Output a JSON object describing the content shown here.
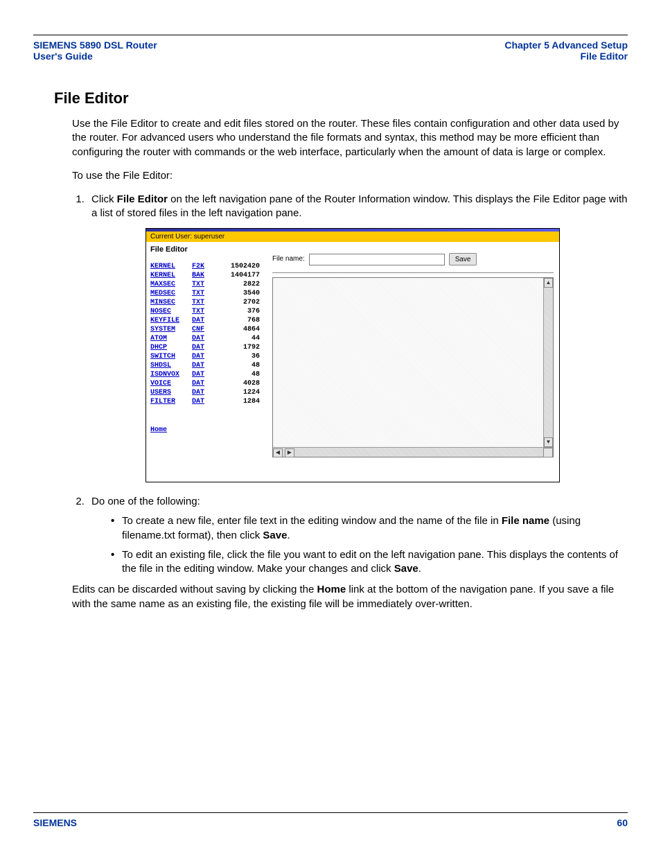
{
  "header": {
    "left_line1": "SIEMENS 5890 DSL Router",
    "left_line2": "User's Guide",
    "right_line1": "Chapter 5  Advanced Setup",
    "right_line2": "File Editor"
  },
  "heading": "File Editor",
  "intro": "Use the File Editor to create and edit files stored on the router. These files contain configuration and other data used by the router. For advanced users who understand the file formats and syntax, this method may be more efficient than configuring the router with commands or the web interface, particularly when the amount of data is large or complex.",
  "lead_in": "To use the File Editor:",
  "step1_pre": "Click ",
  "step1_bold": "File Editor",
  "step1_post": " on the left navigation pane of the Router Information window. This displays the File Editor page with a list of stored files in the left navigation pane.",
  "screenshot": {
    "user_bar": "Current User: superuser",
    "side_title": "File Editor",
    "files": [
      {
        "name": "KERNEL",
        "ext": "F2K",
        "size": "1502420"
      },
      {
        "name": "KERNEL",
        "ext": "BAK",
        "size": "1404177"
      },
      {
        "name": "MAXSEC",
        "ext": "TXT",
        "size": "2822"
      },
      {
        "name": "MEDSEC",
        "ext": "TXT",
        "size": "3540"
      },
      {
        "name": "MINSEC",
        "ext": "TXT",
        "size": "2702"
      },
      {
        "name": "NOSEC",
        "ext": "TXT",
        "size": "376"
      },
      {
        "name": "KEYFILE",
        "ext": "DAT",
        "size": "768"
      },
      {
        "name": "SYSTEM",
        "ext": "CNF",
        "size": "4864"
      },
      {
        "name": "ATOM",
        "ext": "DAT",
        "size": "44"
      },
      {
        "name": "DHCP",
        "ext": "DAT",
        "size": "1792"
      },
      {
        "name": "SWITCH",
        "ext": "DAT",
        "size": "36"
      },
      {
        "name": "SHDSL",
        "ext": "DAT",
        "size": "48"
      },
      {
        "name": "ISDNVOX",
        "ext": "DAT",
        "size": "48"
      },
      {
        "name": "VOICE",
        "ext": "DAT",
        "size": "4028"
      },
      {
        "name": "USERS",
        "ext": "DAT",
        "size": "1224"
      },
      {
        "name": "FILTER",
        "ext": "DAT",
        "size": "1284"
      }
    ],
    "home_link": "Home",
    "file_name_label": "File name:",
    "save_label": "Save"
  },
  "step2_lead": "Do one of the following:",
  "bullet1_pre": "To create a new file, enter file text in the editing window and the name of the file in ",
  "bullet1_b1": "File name",
  "bullet1_mid": " (using filename.txt format), then click ",
  "bullet1_b2": "Save",
  "bullet1_post": ".",
  "bullet2_pre": "To edit an existing file, click the file you want to edit on the left navigation pane. This displays the contents of the file in the editing window. Make your changes and click ",
  "bullet2_b1": "Save",
  "bullet2_post": ".",
  "closing_pre": "Edits can be discarded without saving by clicking the ",
  "closing_b": "Home",
  "closing_post": " link at the bottom of the navigation pane. If you save a file with the same name as an existing file, the existing file will be immediately over-written.",
  "footer": {
    "brand": "SIEMENS",
    "page": "60"
  }
}
